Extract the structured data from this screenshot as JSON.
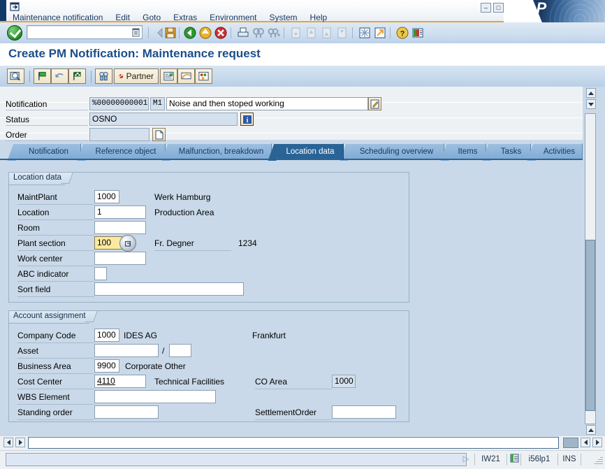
{
  "window": {
    "title_icon": "sap-session-icon",
    "minimize": "–",
    "maximize": "□",
    "close": "✕",
    "logo": "SAP"
  },
  "menubar": {
    "items": [
      {
        "label": "Maintenance notification",
        "accel": "M"
      },
      {
        "label": "Edit",
        "accel": "E"
      },
      {
        "label": "Goto",
        "accel": "G"
      },
      {
        "label": "Extras",
        "accel": "a"
      },
      {
        "label": "Environment",
        "accel": "n"
      },
      {
        "label": "System",
        "accel": "y"
      },
      {
        "label": "Help",
        "accel": "H"
      }
    ]
  },
  "toolbar": {
    "enter_icon": "green-check-enter-icon",
    "command_field": {
      "value": "",
      "placeholder": ""
    },
    "command_dropdown_icon": "command-history-icon",
    "buttons": [
      {
        "name": "back-history-icon",
        "glyph": "◁"
      },
      {
        "name": "save-icon",
        "glyph": "💾"
      },
      {
        "name": "back-green-icon",
        "glyph": "⬅"
      },
      {
        "name": "exit-yellow-icon",
        "glyph": "⬆"
      },
      {
        "name": "cancel-red-icon",
        "glyph": "✖"
      },
      {
        "name": "print-icon",
        "glyph": "🖶"
      },
      {
        "name": "find-icon",
        "glyph": "🔍"
      },
      {
        "name": "find-next-icon",
        "glyph": "🔎"
      },
      {
        "name": "first-page-icon",
        "glyph": "⏫"
      },
      {
        "name": "previous-page-icon",
        "glyph": "🔼"
      },
      {
        "name": "next-page-icon",
        "glyph": "🔽"
      },
      {
        "name": "last-page-icon",
        "glyph": "⏬"
      },
      {
        "name": "new-session-icon",
        "glyph": "❇"
      },
      {
        "name": "create-shortcut-icon",
        "glyph": "↗"
      },
      {
        "name": "help-icon",
        "glyph": "?"
      },
      {
        "name": "customize-layout-icon",
        "glyph": "▤"
      }
    ]
  },
  "page_title": "Create PM Notification: Maintenance request",
  "app_toolbar": {
    "buttons": [
      {
        "name": "display-overview-button",
        "icon": "magnifier-list-icon",
        "label": ""
      },
      {
        "name": "flag-green-button",
        "icon": "flag-green-icon",
        "label": ""
      },
      {
        "name": "undo-flag-button",
        "icon": "flag-undo-icon",
        "label": ""
      },
      {
        "name": "flag-checkered-button",
        "icon": "flag-checkered-icon",
        "label": ""
      },
      {
        "name": "find-partner-button",
        "icon": "binoculars-icon",
        "label": ""
      },
      {
        "name": "partner-button",
        "icon": "partner-wheel-icon",
        "label": "Partner"
      },
      {
        "name": "long-text-button",
        "icon": "document-text-icon",
        "label": ""
      },
      {
        "name": "action-log-button",
        "icon": "signature-icon",
        "label": ""
      },
      {
        "name": "object-info-button",
        "icon": "object-info-icon",
        "label": ""
      }
    ]
  },
  "header": {
    "rows": [
      {
        "label": "Notification",
        "number": "%00000000001",
        "type": "M1",
        "description": "Noise and then stoped working",
        "edit_icon": "edit-pencil-icon"
      },
      {
        "label": "Status",
        "value": "OSNO",
        "info_icon": "info-blue-icon"
      },
      {
        "label": "Order",
        "value": "",
        "doc_icon": "document-new-icon"
      }
    ]
  },
  "tabs": [
    {
      "label": "Notification",
      "active": false
    },
    {
      "label": "Reference object",
      "active": false
    },
    {
      "label": "Malfunction, breakdown",
      "active": false
    },
    {
      "label": "Location data",
      "active": true
    },
    {
      "label": "Scheduling overview",
      "active": false
    },
    {
      "label": "Items",
      "active": false
    },
    {
      "label": "Tasks",
      "active": false
    },
    {
      "label": "Activities",
      "active": false
    }
  ],
  "location_data": {
    "group_title": "Location data",
    "fields": [
      {
        "label": "MaintPlant",
        "value": "1000",
        "text": "Werk Hamburg",
        "extra": ""
      },
      {
        "label": "Location",
        "value": "1",
        "text": "Production Area",
        "extra": ""
      },
      {
        "label": "Room",
        "value": "",
        "text": "",
        "extra": ""
      },
      {
        "label": "Plant section",
        "value": "100",
        "text": "Fr. Degner",
        "extra": "1234"
      },
      {
        "label": "Work center",
        "value": "",
        "text": "",
        "extra": ""
      },
      {
        "label": "ABC indicator",
        "value": "",
        "text": "",
        "extra": ""
      },
      {
        "label": "Sort field",
        "value": "",
        "text": "",
        "extra": ""
      }
    ],
    "search_help_icon": "search-help-icon"
  },
  "account_assignment": {
    "group_title": "Account assignment",
    "fields": [
      {
        "label": "Company Code",
        "value": "1000",
        "text": "IDES AG",
        "extra_label": "",
        "extra_value": "Frankfurt"
      },
      {
        "label": "Asset",
        "value": "",
        "text": "/",
        "extra_label": "",
        "extra_value": ""
      },
      {
        "label": "Business Area",
        "value": "9900",
        "text": "Corporate Other",
        "extra_label": "",
        "extra_value": ""
      },
      {
        "label": "Cost Center",
        "value": "4110",
        "text": "Technical Facilities",
        "extra_label": "CO Area",
        "extra_value": "1000"
      },
      {
        "label": "WBS Element",
        "value": "",
        "text": "",
        "extra_label": "",
        "extra_value": ""
      },
      {
        "label": "Standing order",
        "value": "",
        "text": "",
        "extra_label": "SettlementOrder",
        "extra_value": ""
      }
    ]
  },
  "statusbar": {
    "message": "",
    "expand_icon": "status-expand-icon",
    "transaction": "IW21",
    "transaction_icon": "transaction-servers-icon",
    "system": "i56lp1",
    "insert_mode": "INS"
  },
  "colors": {
    "accent_blue": "#2a6496",
    "content_bg": "#c9d9e9",
    "title_text": "#1a4e8a",
    "focus_field": "#fce9a0",
    "orange_rule": "#e8a33d"
  }
}
